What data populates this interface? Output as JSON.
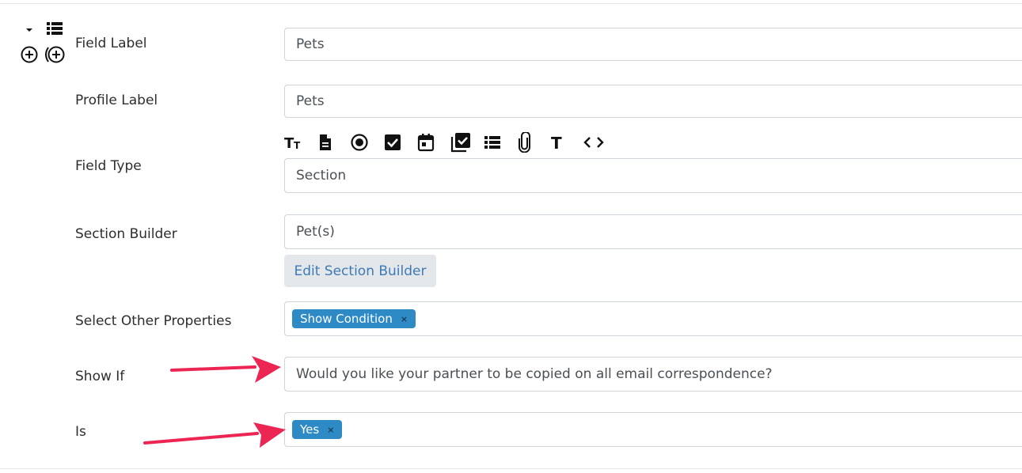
{
  "row_controls": {
    "collapse_icon": "caret-down-icon",
    "list_icon": "list-icon",
    "add_icon": "plus-circle-icon",
    "add_nested_icon": "nested-plus-circle-icon"
  },
  "fields": {
    "field_label": {
      "label": "Field Label",
      "value": "Pets"
    },
    "profile_label": {
      "label": "Profile Label",
      "value": "Pets"
    },
    "field_type": {
      "label": "Field Type",
      "value": "Section",
      "type_icons": [
        "text-size-icon",
        "document-icon",
        "radio-icon",
        "checkbox-icon",
        "calendar-icon",
        "multi-checkbox-icon",
        "list-icon",
        "paperclip-icon",
        "text-icon",
        "code-icon"
      ]
    },
    "section_builder": {
      "label": "Section Builder",
      "value": "Pet(s)",
      "edit_button": "Edit Section Builder"
    },
    "other_properties": {
      "label": "Select Other Properties",
      "tag": "Show Condition",
      "remove": "×"
    },
    "show_if": {
      "label": "Show If",
      "value": "Would you like your partner to be copied on all email correspondence?"
    },
    "is": {
      "label": "Is",
      "tag": "Yes",
      "remove": "×"
    }
  },
  "colors": {
    "tag_bg": "#2e8ac4",
    "arrow": "#ec2553",
    "button_text": "#3d7ab5",
    "button_bg": "#e4e7ea"
  }
}
